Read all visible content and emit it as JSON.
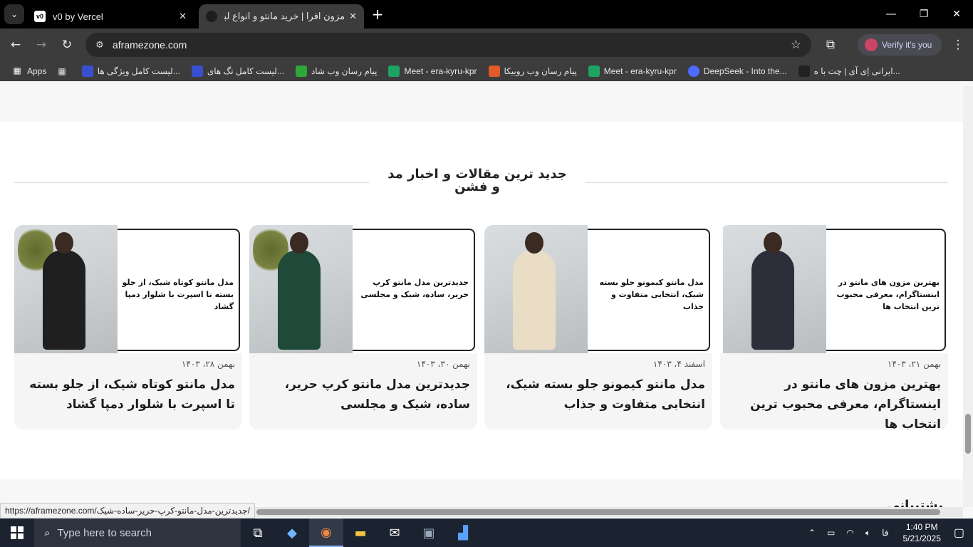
{
  "browser": {
    "tabs": [
      {
        "title": "v0 by Vercel",
        "favicon": "v0-icon"
      },
      {
        "title": "مزون افرا | خرید مانتو و انواع لباس",
        "favicon": "afra-icon"
      }
    ],
    "url": "aframezone.com",
    "verify_label": "Verify it's you",
    "bookmarks": [
      {
        "label": "Apps"
      },
      {
        "label": "لیست کامل ویژگی ها...",
        "color": "#3a4fd0"
      },
      {
        "label": "لیست کامل تگ های...",
        "color": "#3a4fd0"
      },
      {
        "label": "پیام رسان وب شاد",
        "color": "#2fa83a"
      },
      {
        "label": "Meet - era-kyru-kpr",
        "color": "#1ea362"
      },
      {
        "label": "پیام رسان وب روبیکا",
        "color": "#e05a2a"
      },
      {
        "label": "Meet - era-kyru-kpr",
        "color": "#1ea362"
      },
      {
        "label": "DeepSeek - Into the...",
        "color": "#4d6bfe"
      },
      {
        "label": "ایرانی اِی آی | چت با ه...",
        "color": "#222"
      }
    ]
  },
  "section": {
    "title": "جدید ترین مقالات و اخبار مد و فشن",
    "next_title": "پشتیبانی"
  },
  "articles": [
    {
      "caption": "بهترین مزون های مانتو در اینستاگرام، معرفی محبوب ترین انتخاب ها",
      "date": "بهمن ۲۱، ۱۴۰۳",
      "heading": "بهترین مزون های مانتو در اینستاگرام، معرفی محبوب ترین انتخاب ها"
    },
    {
      "caption": "مدل مانتو کیمونو جلو بسته شیک، انتخابی متفاوت و جذاب",
      "date": "اسفند ۴، ۱۴۰۳",
      "heading": "مدل مانتو کیمونو جلو بسته شیک، انتخابی متفاوت و جذاب"
    },
    {
      "caption": "جدیدترین مدل مانتو کرپ حریر، ساده، شیک و مجلسی",
      "date": "بهمن ۳۰، ۱۴۰۳",
      "heading": "جدیدترین مدل مانتو کرپ حریر، ساده، شیک و مجلسی"
    },
    {
      "caption": "مدل مانتو کوتاه شیک، از جلو بسته تا اسپرت با شلوار دمپا گشاد",
      "date": "بهمن ۲۸، ۱۴۰۳",
      "heading": "مدل مانتو کوتاه شیک، از جلو بسته تا اسپرت با شلوار دمپا گشاد"
    }
  ],
  "status_url": "https://aframezone.com/جدیدترین-مدل-مانتو-کرپ-حریر-ساده-شیک/",
  "taskbar": {
    "search_placeholder": "Type here to search",
    "lang": "فا",
    "time": "1:40 PM",
    "date": "5/21/2025"
  }
}
